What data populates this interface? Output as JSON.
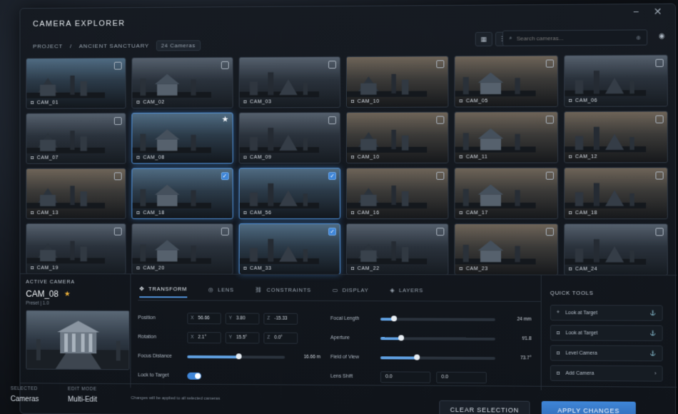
{
  "window": {
    "title": "CAMERA EXPLORER",
    "minimize_icon": "−",
    "close_icon": "✕"
  },
  "breadcrumb": {
    "root": "PROJECT",
    "separator": "/",
    "current": "ANCIENT SANCTUARY",
    "count": "24 Cameras"
  },
  "search": {
    "placeholder": "Search cameras..."
  },
  "tiles": [
    {
      "label": "CAM_01",
      "selected": false,
      "starred": false,
      "tone": "cool"
    },
    {
      "label": "CAM_02",
      "selected": false,
      "starred": false,
      "tone": ""
    },
    {
      "label": "CAM_03",
      "selected": false,
      "starred": false,
      "tone": ""
    },
    {
      "label": "CAM_10",
      "selected": false,
      "starred": false,
      "tone": "warm"
    },
    {
      "label": "CAM_05",
      "selected": false,
      "starred": false,
      "tone": "warm"
    },
    {
      "label": "CAM_06",
      "selected": false,
      "starred": false,
      "tone": ""
    },
    {
      "label": "CAM_07",
      "selected": false,
      "starred": false,
      "tone": ""
    },
    {
      "label": "CAM_08",
      "selected": true,
      "starred": true,
      "tone": "cool"
    },
    {
      "label": "CAM_09",
      "selected": false,
      "starred": false,
      "tone": ""
    },
    {
      "label": "CAM_10",
      "selected": false,
      "starred": false,
      "tone": "warm"
    },
    {
      "label": "CAM_11",
      "selected": false,
      "starred": false,
      "tone": "warm"
    },
    {
      "label": "CAM_12",
      "selected": false,
      "starred": false,
      "tone": "warm"
    },
    {
      "label": "CAM_13",
      "selected": false,
      "starred": false,
      "tone": "warm"
    },
    {
      "label": "CAM_18",
      "selected": true,
      "starred": false,
      "checked": true,
      "tone": "cool"
    },
    {
      "label": "CAM_56",
      "selected": true,
      "starred": false,
      "checked": true,
      "tone": "cool"
    },
    {
      "label": "CAM_16",
      "selected": false,
      "starred": false,
      "tone": "warm"
    },
    {
      "label": "CAM_17",
      "selected": false,
      "starred": false,
      "tone": "warm"
    },
    {
      "label": "CAM_18",
      "selected": false,
      "starred": false,
      "tone": "warm"
    },
    {
      "label": "CAM_19",
      "selected": false,
      "starred": false,
      "tone": ""
    },
    {
      "label": "CAM_20",
      "selected": false,
      "starred": false,
      "tone": ""
    },
    {
      "label": "CAM_33",
      "selected": true,
      "starred": false,
      "checked": true,
      "tone": "cool"
    },
    {
      "label": "CAM_22",
      "selected": false,
      "starred": false,
      "tone": ""
    },
    {
      "label": "CAM_23",
      "selected": false,
      "starred": false,
      "tone": "warm"
    },
    {
      "label": "CAM_24",
      "selected": false,
      "starred": false,
      "tone": ""
    }
  ],
  "active_camera": {
    "title": "ACTIVE CAMERA",
    "name": "CAM_08",
    "sub": "Preset | 1.0"
  },
  "tabs": [
    "TRANSFORM",
    "LENS",
    "CONSTRAINTS",
    "DISPLAY",
    "LAYERS"
  ],
  "transform": {
    "position_label": "Position",
    "pos_x": "56.66",
    "pos_y": "3.80",
    "pos_z": "-15.33",
    "rotation_label": "Rotation",
    "rot_x": "2.1°",
    "rot_y": "15.5°",
    "rot_z": "0.0°",
    "focus_label": "Focus Distance",
    "focus_value": "16.66 m",
    "focus_level": 0.53,
    "lock_label": "Lock to Target",
    "lock_on": true
  },
  "lens": {
    "focal_label": "Focal Length",
    "focal_value": "24 mm",
    "focal_level": 0.12,
    "aperture_label": "Aperture",
    "aperture_value": "f/1.8",
    "aperture_level": 0.18,
    "fov_label": "Field of View",
    "fov_value": "73.7°",
    "fov_level": 0.32,
    "shift_label": "Lens Shift",
    "shift_x": "0.0",
    "shift_y": "0.0"
  },
  "quick_tools": {
    "title": "QUICK TOOLS",
    "items": [
      "Look at Target",
      "Look at Target",
      "Level Camera",
      "Add Camera"
    ]
  },
  "footer": {
    "selected_label": "SELECTED",
    "selected_value": "Cameras",
    "mode_label": "EDIT MODE",
    "mode_value": "Multi-Edit",
    "note": "Changes will be applied to all selected cameras",
    "clear": "CLEAR SELECTION",
    "apply": "APPLY CHANGES"
  },
  "colors": {
    "accent": "#3f86d8",
    "star": "#f0b33a"
  }
}
